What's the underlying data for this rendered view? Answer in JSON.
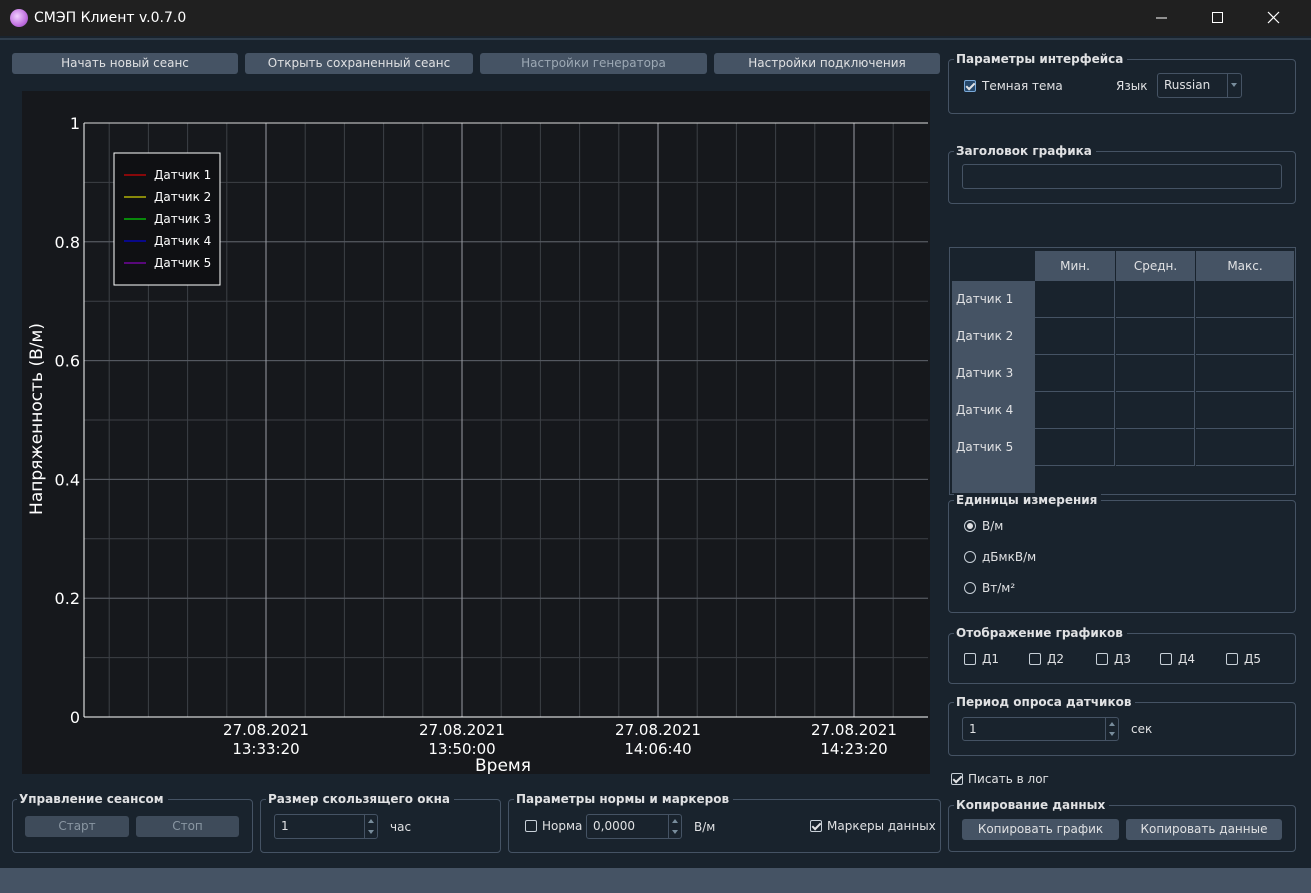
{
  "window": {
    "title": "СМЭП Клиент v.0.7.0"
  },
  "toolbar": {
    "new_session": "Начать новый сеанс",
    "open_session": "Открыть сохраненный сеанс",
    "generator_settings": "Настройки генератора",
    "connection_settings": "Настройки подключения"
  },
  "chart_data": {
    "type": "line",
    "xlabel": "Время",
    "ylabel": "Напряженность (В/м)",
    "ylim": [
      0,
      1
    ],
    "y_ticks": [
      "0",
      "0.2",
      "0.4",
      "0.6",
      "0.8",
      "1"
    ],
    "x_ticks": [
      {
        "date": "27.08.2021",
        "time": "13:33:20"
      },
      {
        "date": "27.08.2021",
        "time": "13:50:00"
      },
      {
        "date": "27.08.2021",
        "time": "14:06:40"
      },
      {
        "date": "27.08.2021",
        "time": "14:23:20"
      }
    ],
    "grid": true,
    "legend_position": "top-left",
    "series": [
      {
        "name": "Датчик 1",
        "color": "#ff0000",
        "values": []
      },
      {
        "name": "Датчик 2",
        "color": "#ffff00",
        "values": []
      },
      {
        "name": "Датчик 3",
        "color": "#00ff00",
        "values": []
      },
      {
        "name": "Датчик 4",
        "color": "#0000ff",
        "values": []
      },
      {
        "name": "Датчик 5",
        "color": "#a000e0",
        "values": []
      }
    ]
  },
  "interface_params": {
    "title": "Параметры интерфейса",
    "dark_theme_label": "Темная тема",
    "dark_theme_checked": true,
    "language_label": "Язык",
    "language_value": "Russian"
  },
  "chart_title_group": {
    "title": "Заголовок графика",
    "value": ""
  },
  "stats_table": {
    "columns": [
      "Мин.",
      "Средн.",
      "Макс."
    ],
    "rows": [
      "Датчик 1",
      "Датчик 2",
      "Датчик 3",
      "Датчик 4",
      "Датчик 5"
    ]
  },
  "units": {
    "title": "Единицы измерения",
    "options": [
      "В/м",
      "дБмкВ/м",
      "Вт/м²"
    ],
    "selected": "В/м"
  },
  "plots_display": {
    "title": "Отображение графиков",
    "items": [
      "Д1",
      "Д2",
      "Д3",
      "Д4",
      "Д5"
    ]
  },
  "poll_period": {
    "title": "Период опроса датчиков",
    "value": "1",
    "unit": "сек"
  },
  "write_log": {
    "label": "Писать в лог",
    "checked": true
  },
  "copy_data": {
    "title": "Копирование данных",
    "copy_chart": "Копировать график",
    "copy_data": "Копировать данные"
  },
  "session_control": {
    "title": "Управление сеансом",
    "start": "Старт",
    "stop": "Стоп"
  },
  "window_size": {
    "title": "Размер скользящего окна",
    "value": "1",
    "unit": "час"
  },
  "norm_markers": {
    "title": "Параметры нормы и маркеров",
    "norm_label": "Норма",
    "norm_checked": false,
    "norm_value": "0,0000",
    "unit": "В/м",
    "markers_label": "Маркеры данных",
    "markers_checked": true
  }
}
